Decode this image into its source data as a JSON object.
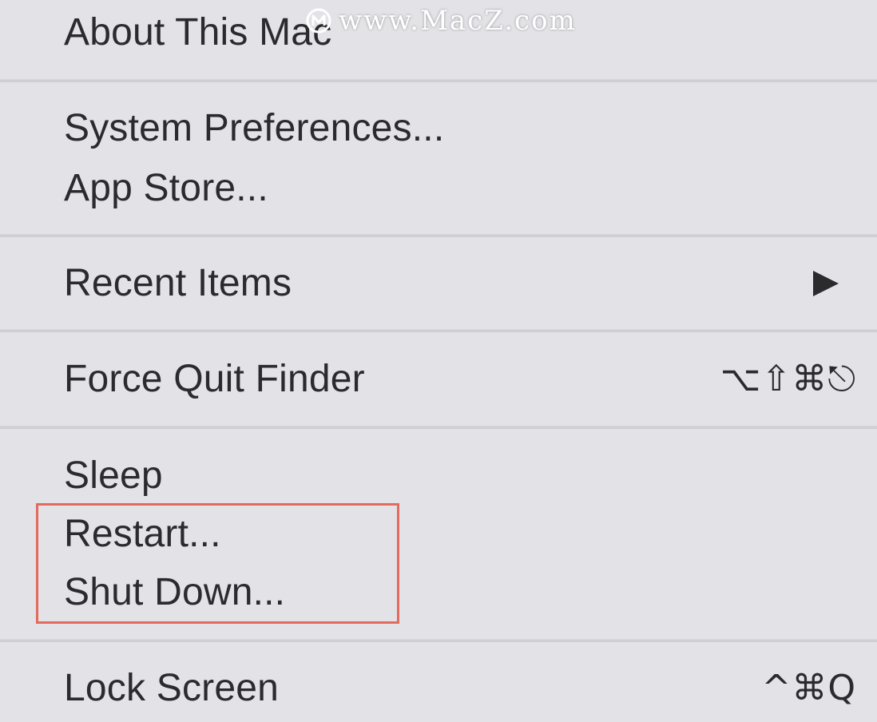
{
  "menu": {
    "items": [
      {
        "label": "About This Mac"
      },
      {
        "label": "System Preferences..."
      },
      {
        "label": "App Store..."
      },
      {
        "label": "Recent Items",
        "submenu": true
      },
      {
        "label": "Force Quit Finder",
        "shortcut": "⌥⇧⌘⎋"
      },
      {
        "label": "Sleep"
      },
      {
        "label": "Restart..."
      },
      {
        "label": "Shut Down..."
      },
      {
        "label": "Lock Screen",
        "shortcut": "^⌘Q"
      }
    ]
  },
  "annotation": {
    "highlight_color": "#e36a5c",
    "highlighted_items": [
      "Restart...",
      "Shut Down..."
    ]
  },
  "watermark": {
    "text": "www.MacZ.com",
    "icon": "macz-logo-icon"
  },
  "colors": {
    "menu_background": "#e3e2e7",
    "text": "#2b2b2e",
    "separator": "#cfced3"
  }
}
